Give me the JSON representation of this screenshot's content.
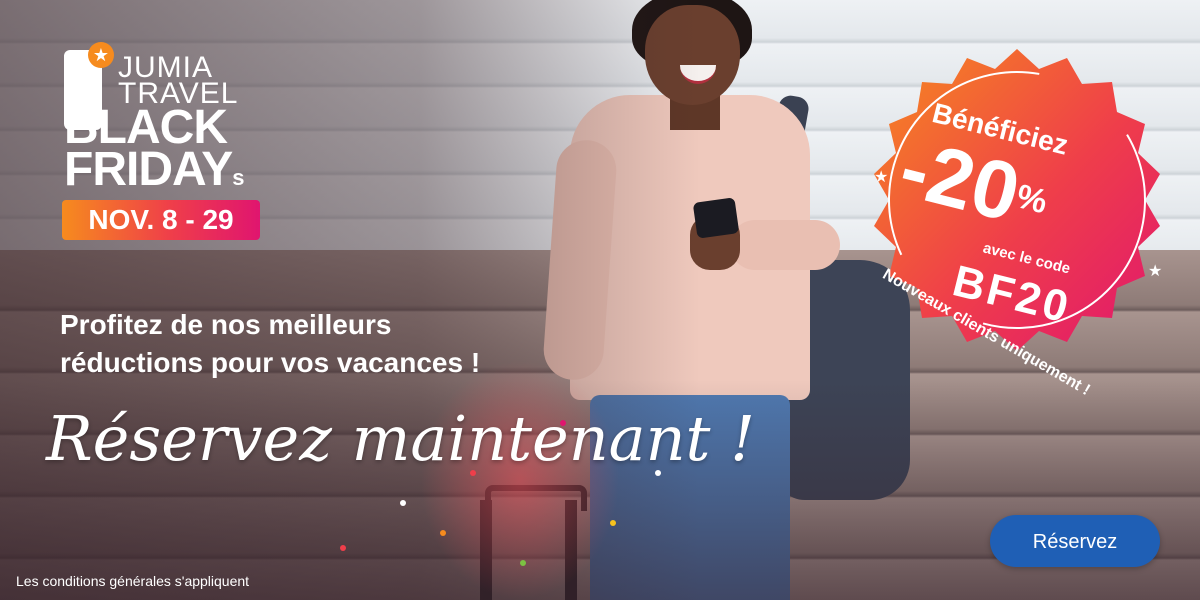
{
  "logo": {
    "line1": "JUMIA",
    "line2": "TRAVEL",
    "line3": "BLACK",
    "line4": "FRIDAY",
    "line4_suffix": "s",
    "dates": "NOV. 8 - 29",
    "star_icon": "star-icon",
    "colors": {
      "orange": "#f68b1e",
      "pink": "#e0156f"
    }
  },
  "headline": {
    "line1": "Profitez de nos meilleurs",
    "line2": "réductions pour vos vacances !"
  },
  "script_title": "Réservez maintenant !",
  "promo": {
    "intro": "Bénéficiez",
    "discount": "-20",
    "percent": "%",
    "code_label": "avec le code",
    "code": "BF20",
    "note": "Nouveaux clients uniquement !"
  },
  "cta": {
    "label": "Réservez",
    "color": "#1f5fb5"
  },
  "footer": {
    "conditions": "Les conditions générales s'appliquent"
  }
}
